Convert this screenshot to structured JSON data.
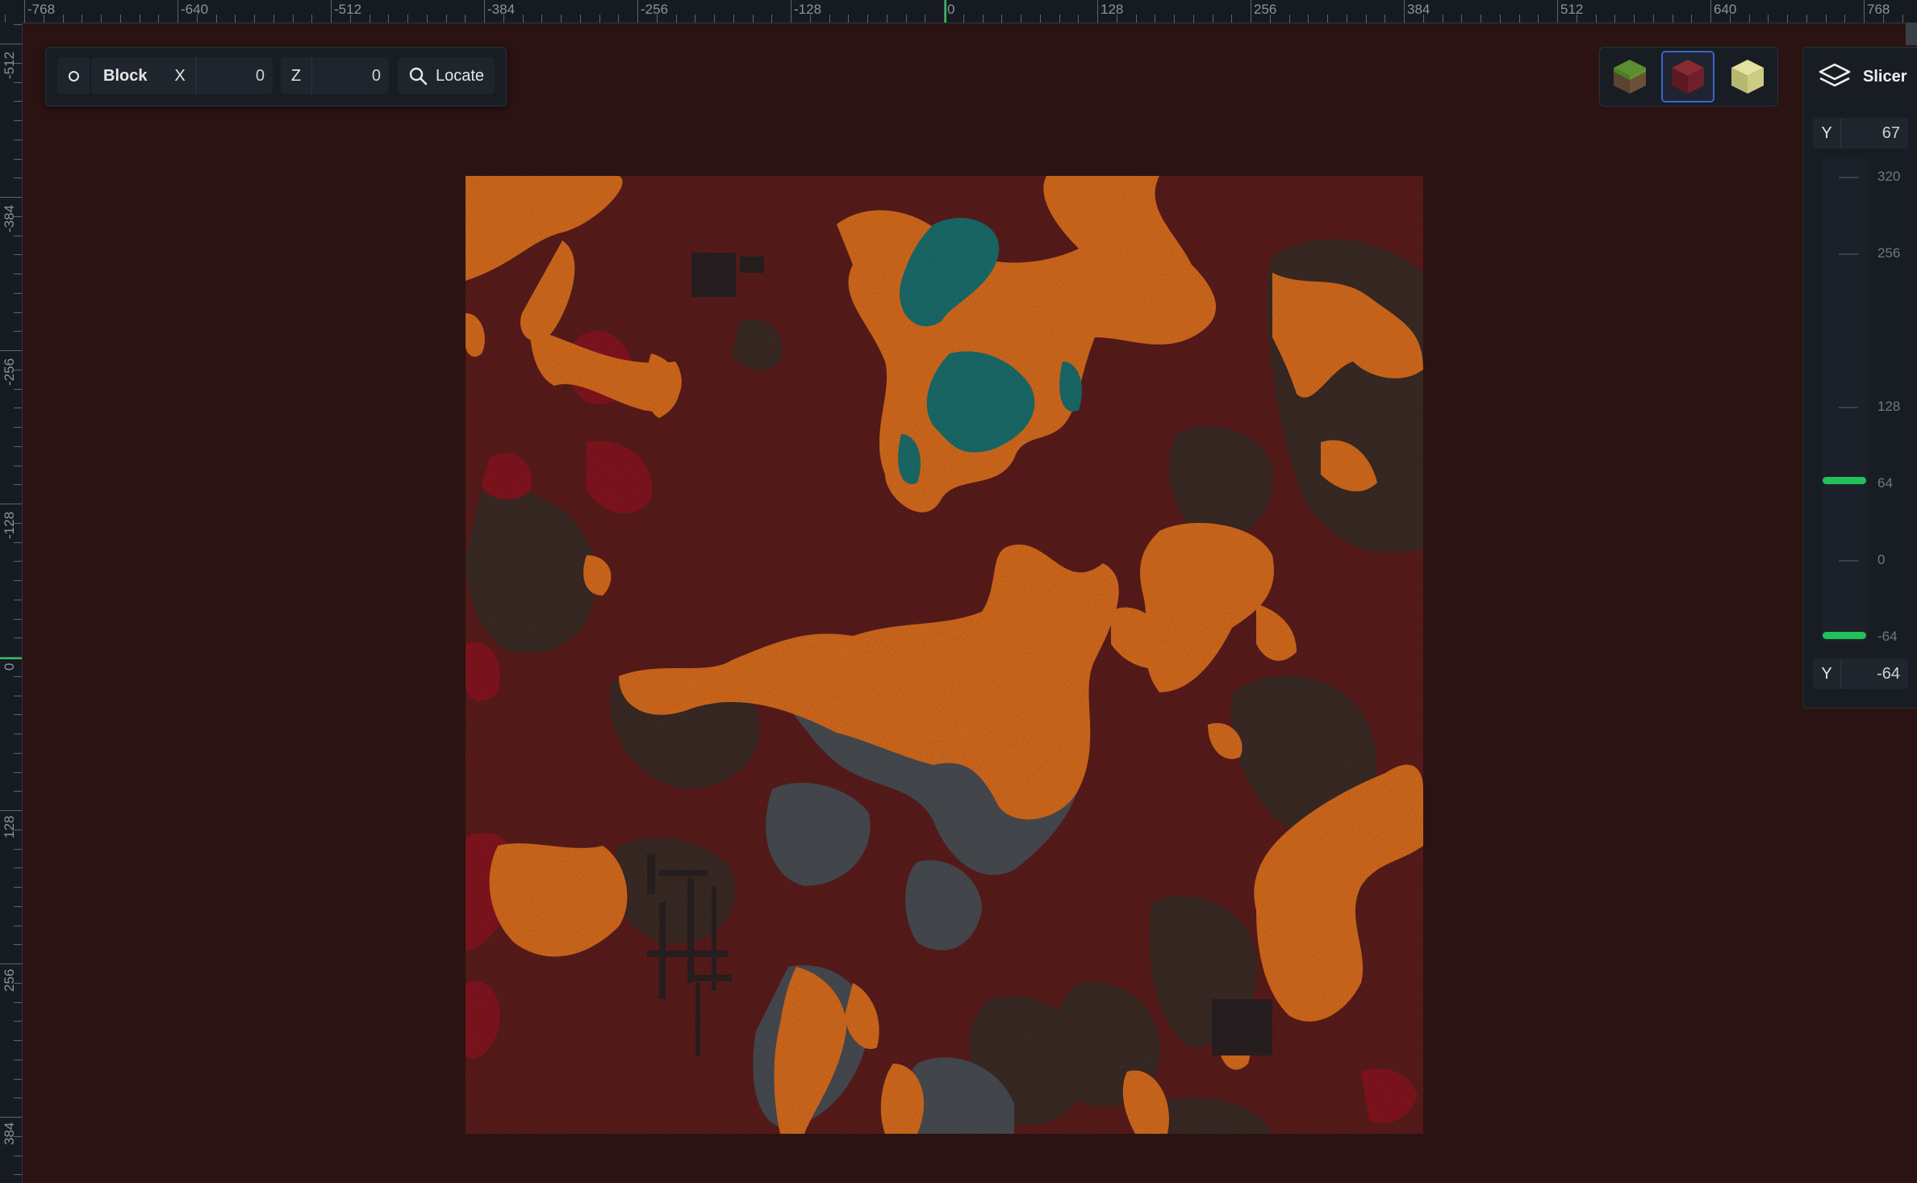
{
  "ruler": {
    "top_labels": [
      "-768",
      "-640",
      "-512",
      "-384",
      "-256",
      "-128",
      "0",
      "128",
      "256",
      "384",
      "512",
      "640",
      "768"
    ],
    "left_labels": [
      "-512",
      "-384",
      "-256",
      "-128",
      "0",
      "128",
      "256",
      "384"
    ]
  },
  "toolbar": {
    "mode_icon": "circle-dot-icon",
    "mode_label": "Block",
    "x_label": "X",
    "x_value": "0",
    "z_label": "Z",
    "z_value": "0",
    "locate_label": "Locate"
  },
  "dimensions": {
    "items": [
      {
        "name": "overworld",
        "icon": "grass-block-icon",
        "active": false
      },
      {
        "name": "nether",
        "icon": "netherrack-icon",
        "active": true
      },
      {
        "name": "end",
        "icon": "end-stone-icon",
        "active": false
      }
    ]
  },
  "slicer": {
    "title": "Slicer",
    "top_y_label": "Y",
    "top_y_value": "67",
    "bottom_y_label": "Y",
    "bottom_y_value": "-64",
    "scale_labels": [
      "320",
      "256",
      "128",
      "64",
      "0",
      "-64"
    ],
    "upper_level": 67,
    "lower_level": -64
  },
  "colors": {
    "accent": "#2fbf58",
    "active_border": "#3a66c9",
    "netherrack": "#5e1d1c",
    "lava": "#e0701e",
    "warped": "#1b7270",
    "soul": "#3d2c26",
    "basalt": "#4b4f55",
    "crimson": "#8a1520"
  }
}
